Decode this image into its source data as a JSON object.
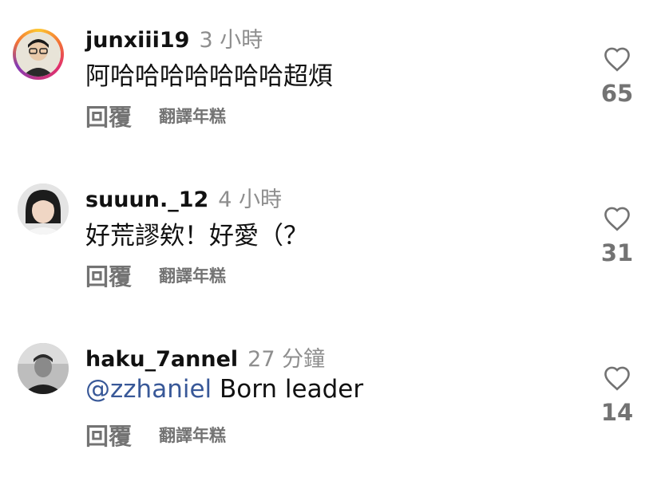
{
  "comments": [
    {
      "username": "junxiii19",
      "time": "3 小時",
      "text": "阿哈哈哈哈哈哈哈超煩",
      "reply_label": "回覆",
      "translate_label": "翻譯年糕",
      "likes": "65",
      "has_story_ring": true
    },
    {
      "username": "suuun._12",
      "time": "4 小時",
      "text": "好荒謬欸！好愛（？",
      "reply_label": "回覆",
      "translate_label": "翻譯年糕",
      "likes": "31",
      "has_story_ring": false
    },
    {
      "username": "haku_7annel",
      "time": "27 分鐘",
      "mention": "@zzhaniel",
      "text": " Born leader",
      "reply_label": "回覆",
      "translate_label": "翻譯年糕",
      "likes": "14",
      "has_story_ring": false
    }
  ],
  "colors": {
    "mention": "#385898",
    "secondary_text": "#737373",
    "time": "#8e8e8e",
    "story_ring": [
      "#fdc830",
      "#e1306c",
      "#833ab4"
    ]
  },
  "icons": {
    "like": "heart-outline-icon"
  }
}
